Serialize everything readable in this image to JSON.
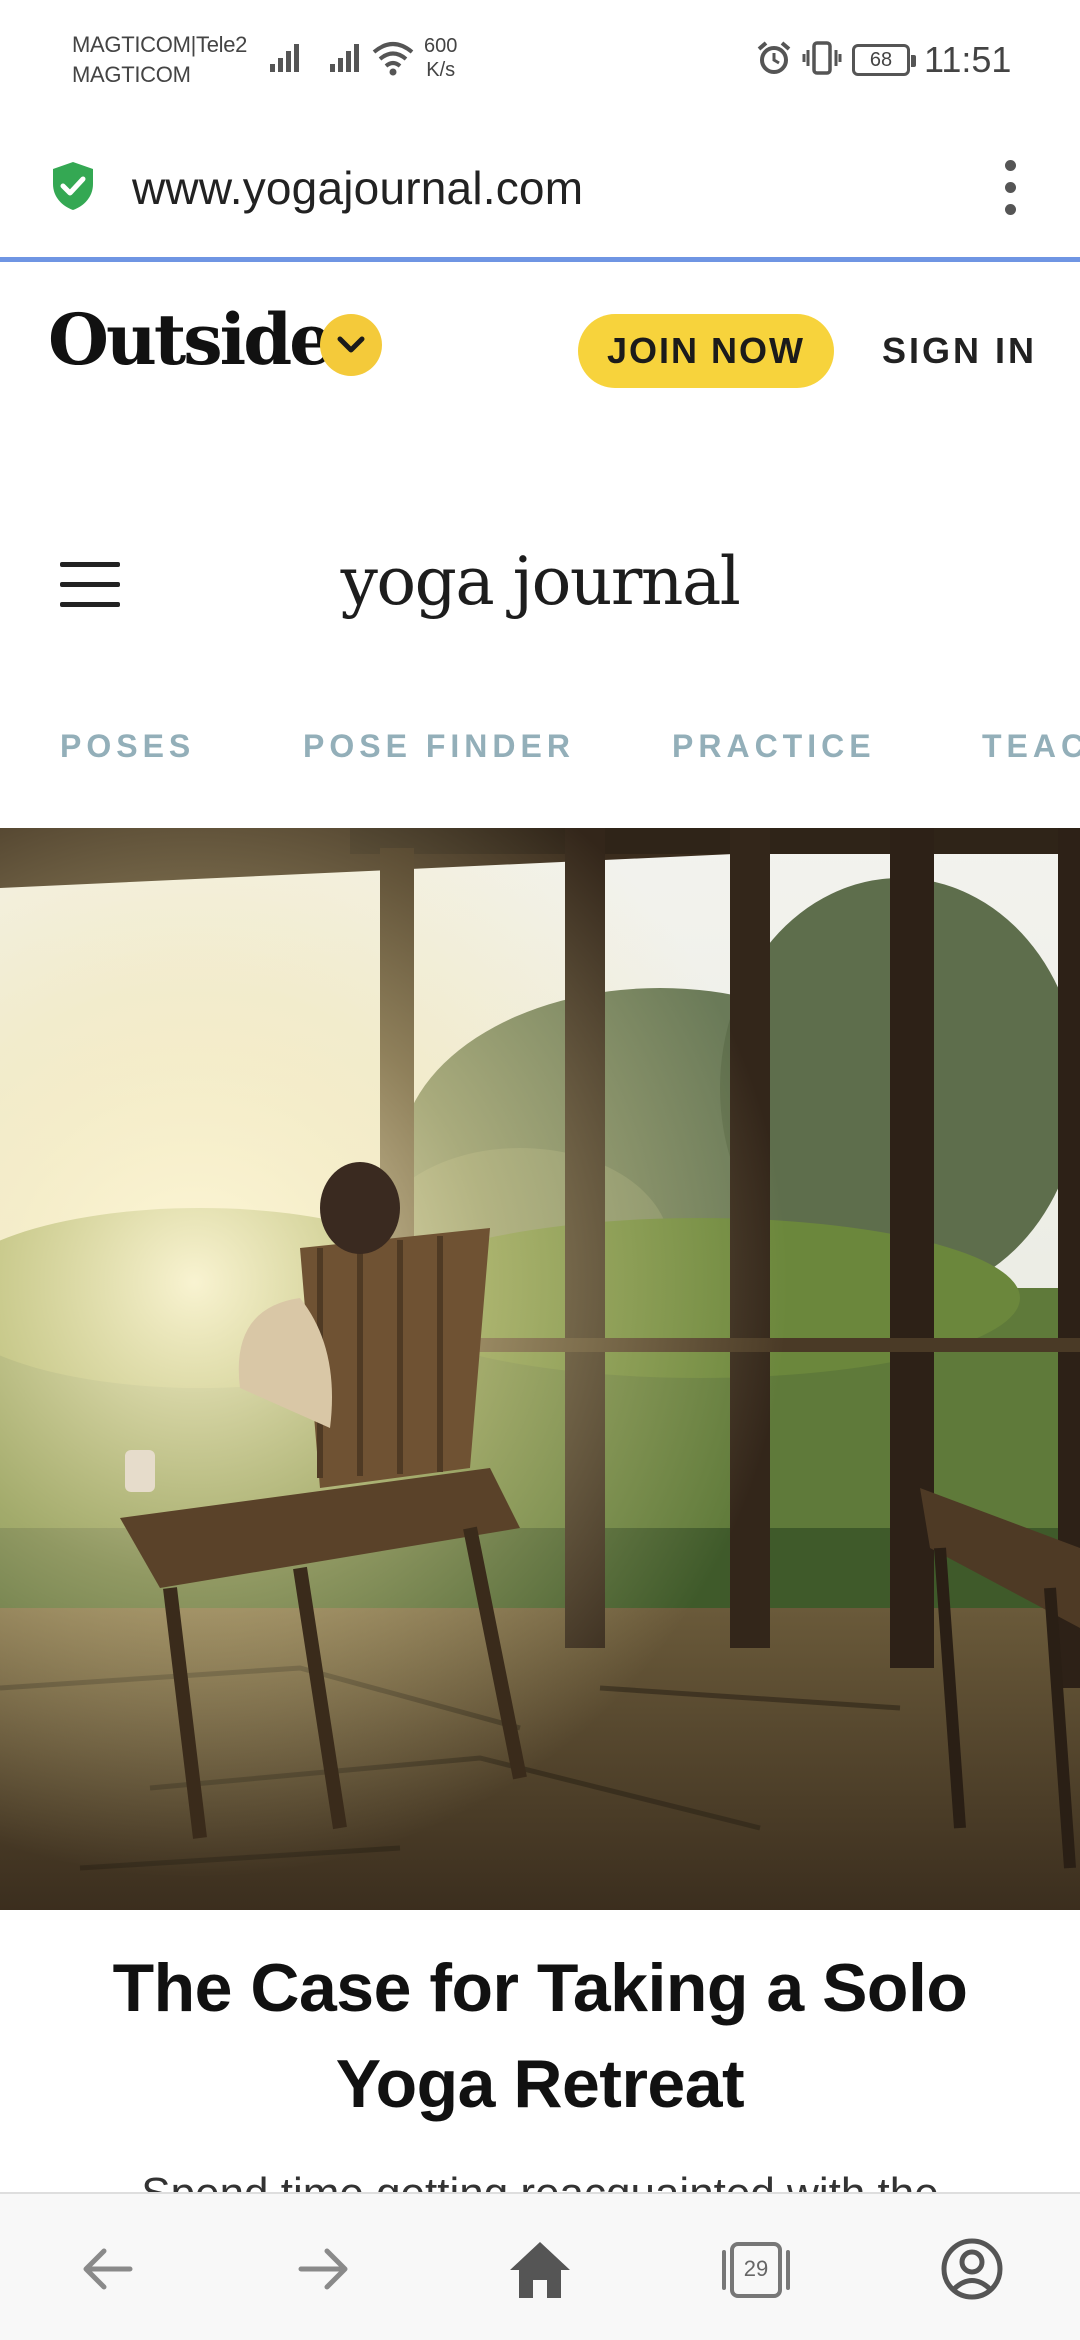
{
  "status_bar": {
    "carrier_line1": "MAGTICOM|Tele2",
    "carrier_line2": "MAGTICOM",
    "speed_value": "600",
    "speed_unit": "K/s",
    "battery": "68",
    "time": "11:51"
  },
  "browser": {
    "url": "www.yogajournal.com",
    "tab_count": "29"
  },
  "outside_header": {
    "logo": "Outside",
    "join_label": "JOIN NOW",
    "signin_label": "SIGN IN"
  },
  "site_header": {
    "logo": "yoga journal"
  },
  "nav": {
    "items": [
      "POSES",
      "POSE FINDER",
      "PRACTICE",
      "TEAC"
    ]
  },
  "article": {
    "headline": "The Case for Taking a Solo Yoga Retreat",
    "dek_partial": "Spend time getting reacquainted with the"
  },
  "colors": {
    "accent_yellow": "#f7d33c",
    "nav_text": "#93afb9",
    "url_underline": "#6f95e3",
    "secure_green": "#34a853"
  },
  "icons": [
    "signal-icon",
    "wifi-icon",
    "alarm-icon",
    "vibrate-icon",
    "battery-icon",
    "shield-check-icon",
    "more-vert-icon",
    "chevron-down-icon",
    "hamburger-icon",
    "back-icon",
    "forward-icon",
    "home-icon",
    "tabs-icon",
    "account-icon"
  ]
}
